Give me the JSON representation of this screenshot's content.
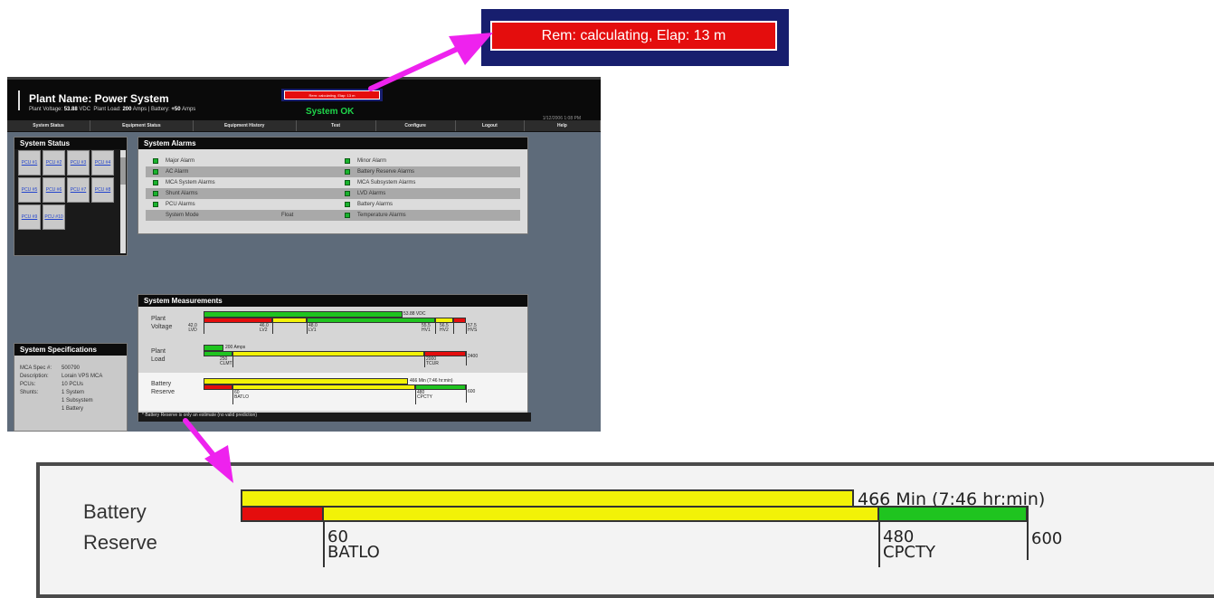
{
  "zoom_top": {
    "text": "Rem: calculating, Elap: 13 m"
  },
  "header": {
    "plant_name": "Plant Name: Power System",
    "voltage_label": "Plant Voltage:",
    "voltage_value": "53.88",
    "voltage_unit": "VDC",
    "load_label": "Plant Load:",
    "load_value": "200",
    "load_unit": "Amps",
    "battery_label": "Battery:",
    "battery_value": "+50",
    "battery_unit": "Amps",
    "alert": "Rem: calculating, Elap: 13 m",
    "status": "System OK",
    "datetime": "1/12/2006 1:08 PM"
  },
  "nav": {
    "tabs": [
      "System Status",
      "Equipment Status",
      "Equipment History",
      "Test",
      "Configure",
      "Logout",
      "Help"
    ]
  },
  "system_status": {
    "title": "System Status",
    "pcus": [
      "PCU #1",
      "PCU #2",
      "PCU #3",
      "PCU #4",
      "PCU #5",
      "PCU #6",
      "PCU #7",
      "PCU #8",
      "PCU #9",
      "PCU #10"
    ]
  },
  "system_alarms": {
    "title": "System Alarms",
    "left": [
      "Major Alarm",
      "AC Alarm",
      "MCA System Alarms",
      "Shunt Alarms",
      "PCU Alarms"
    ],
    "mode_label": "System Mode",
    "mode_value": "Float",
    "right": [
      "Minor Alarm",
      "Battery Reserve Alarms",
      "MCA Subsystem Alarms",
      "LVD Alarms",
      "Battery Alarms",
      "Temperature Alarms"
    ],
    "led_color": "#19b32d"
  },
  "system_measurements": {
    "title": "System Measurements",
    "voltage": {
      "label": [
        "Plant",
        "Voltage"
      ],
      "value_text": "53.88 VDC",
      "ticks": [
        {
          "v": "42.0",
          "n": "LVD"
        },
        {
          "v": "46.0",
          "n": "LV2"
        },
        {
          "v": "48.0",
          "n": "LV1"
        },
        {
          "v": "55.5",
          "n": "HV1"
        },
        {
          "v": "56.5",
          "n": "HV2"
        },
        {
          "v": "57.5",
          "n": "HVS"
        }
      ]
    },
    "load": {
      "label": [
        "Plant",
        "Load"
      ],
      "value_text": "200 Amps",
      "ticks": [
        {
          "v": "250",
          "n": "CLMT"
        },
        {
          "v": "2000",
          "n": "TCUR"
        },
        {
          "v": "2400",
          "n": ""
        }
      ]
    },
    "battery": {
      "label": [
        "Battery",
        "Reserve"
      ],
      "value_text": "466 Min (7:46 hr:min)",
      "ticks": [
        {
          "v": "60",
          "n": "BATLO"
        },
        {
          "v": "480",
          "n": "CPCTY"
        },
        {
          "v": "600",
          "n": ""
        }
      ]
    },
    "footnote": "* Battery Reserve is only an estimate (no valid prediction)"
  },
  "system_specifications": {
    "title": "System Specifications",
    "rows": [
      {
        "k": "MCA Spec #:",
        "v": "500790"
      },
      {
        "k": "Description:",
        "v": "Lorain VPS MCA"
      },
      {
        "k": "PCUs:",
        "v": "10 PCUs"
      },
      {
        "k": "Shunts:",
        "v": "1 System"
      },
      {
        "k": "",
        "v": "1 Subsystem"
      },
      {
        "k": "",
        "v": "1 Battery"
      }
    ]
  },
  "zoom_bottom": {
    "label_line1": "Battery",
    "label_line2": "Reserve",
    "value_text": "466 Min (7:46 hr:min)",
    "tick1_value": "60",
    "tick1_name": "BATLO",
    "tick2_value": "480",
    "tick2_name": "CPCTY",
    "tick3_value": "600"
  },
  "colors": {
    "red": "#e40d0d",
    "yellow": "#f2f207",
    "green": "#1fc41f",
    "magenta": "#ee22ee",
    "navy": "#171e6e"
  }
}
